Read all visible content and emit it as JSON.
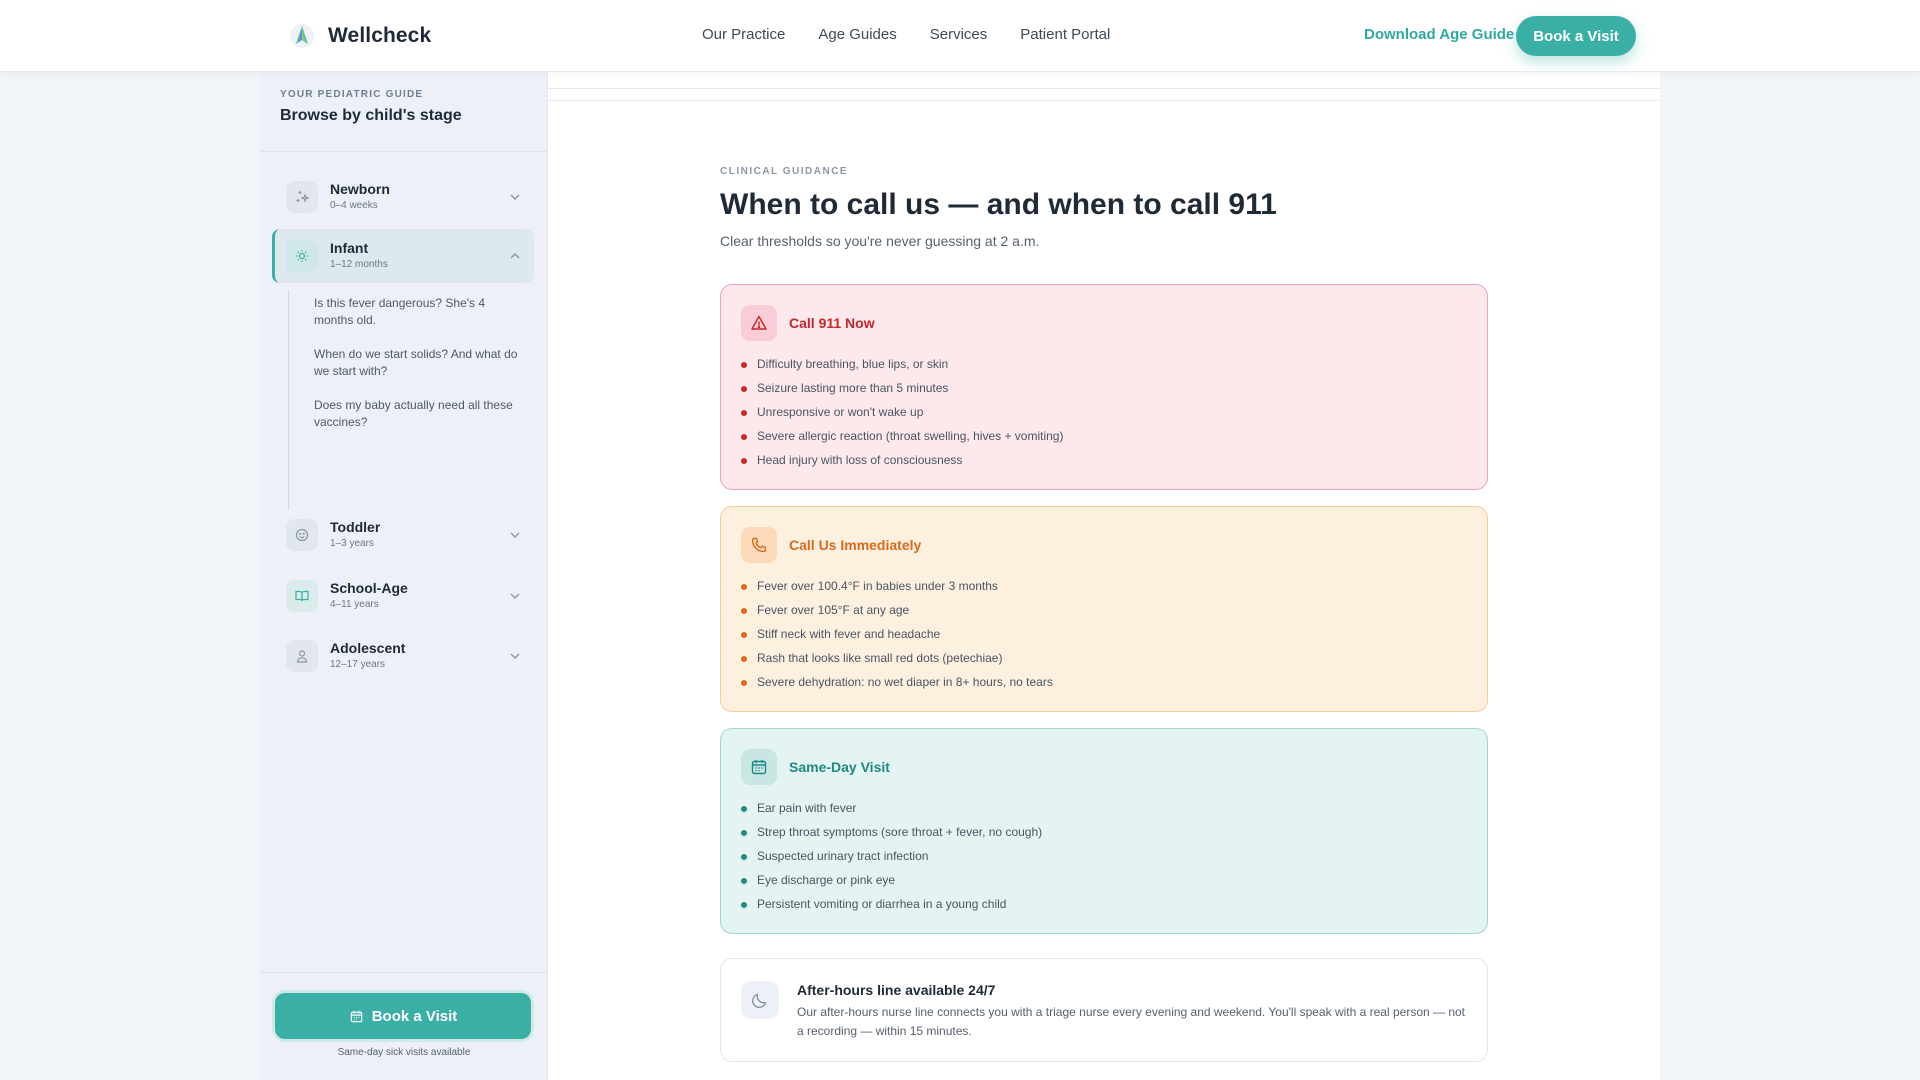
{
  "header": {
    "brand": "Wellcheck",
    "nav": [
      "Our Practice",
      "Age Guides",
      "Services",
      "Patient Portal"
    ],
    "download_label": "Download Age Guide",
    "book_label": "Book a Visit"
  },
  "sidebar": {
    "kicker": "YOUR PEDIATRIC GUIDE",
    "title": "Browse by child's stage",
    "stages": [
      {
        "name": "Newborn",
        "age": "0–4 weeks",
        "icon": "sparkle-icon",
        "expanded": false
      },
      {
        "name": "Infant",
        "age": "1–12 months",
        "icon": "sun-icon",
        "expanded": true
      },
      {
        "name": "Toddler",
        "age": "1–3 years",
        "icon": "smile-icon",
        "expanded": false
      },
      {
        "name": "School-Age",
        "age": "4–11 years",
        "icon": "book-icon",
        "expanded": false
      },
      {
        "name": "Adolescent",
        "age": "12–17 years",
        "icon": "person-icon",
        "expanded": false
      }
    ],
    "infant_questions": [
      "Is this fever dangerous? She's 4 months old.",
      "When do we start solids? And what do we start with?",
      "Does my baby actually need all these vaccines?"
    ],
    "book_label": "Book a Visit",
    "book_note": "Same-day sick visits available"
  },
  "main": {
    "kicker": "CLINICAL GUIDANCE",
    "title": "When to call us — and when to call 911",
    "subtitle": "Clear thresholds so you're never guessing at 2 a.m.",
    "cards": [
      {
        "title": "Call 911 Now",
        "icon": "warning-icon",
        "items": [
          "Difficulty breathing, blue lips, or skin",
          "Seizure lasting more than 5 minutes",
          "Unresponsive or won't wake up",
          "Severe allergic reaction (throat swelling, hives + vomiting)",
          "Head injury with loss of consciousness"
        ]
      },
      {
        "title": "Call Us Immediately",
        "icon": "phone-icon",
        "items": [
          "Fever over 100.4°F in babies under 3 months",
          "Fever over 105°F at any age",
          "Stiff neck with fever and headache",
          "Rash that looks like small red dots (petechiae)",
          "Severe dehydration: no wet diaper in 8+ hours, no tears"
        ]
      },
      {
        "title": "Same-Day Visit",
        "icon": "calendar-icon",
        "items": [
          "Ear pain with fever",
          "Strep throat symptoms (sore throat + fever, no cough)",
          "Suspected urinary tract infection",
          "Eye discharge or pink eye",
          "Persistent vomiting or diarrhea in a young child"
        ]
      }
    ],
    "after_hours": {
      "title": "After-hours line available 24/7",
      "text": "Our after-hours nurse line connects you with a triage nurse every evening and weekend. You'll speak with a real person — not a recording — within 15 minutes.",
      "icon": "moon-icon"
    }
  },
  "colors": {
    "accent": "#3aafa6",
    "emergency": "#c1272d",
    "urgent": "#d96a1a",
    "same_day": "#1f8a82"
  }
}
